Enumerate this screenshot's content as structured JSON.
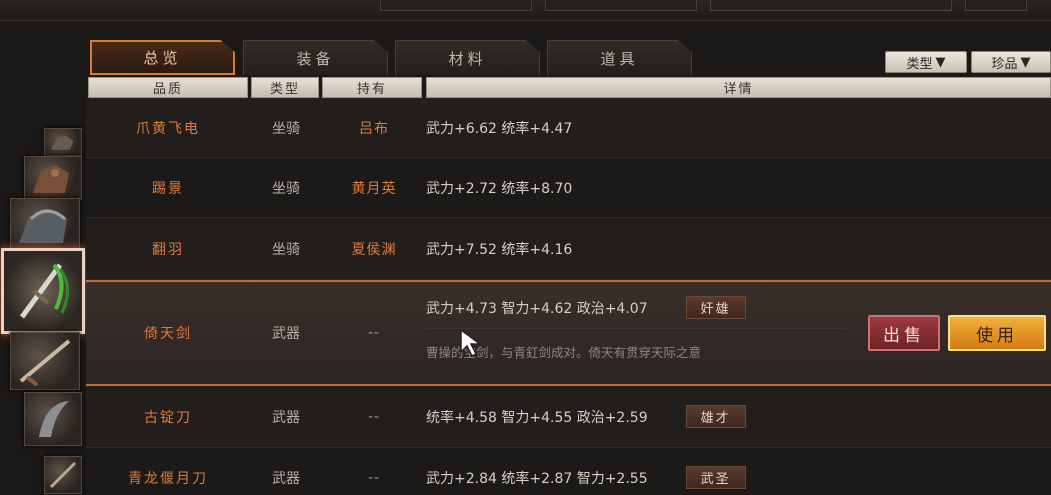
{
  "tabs": [
    {
      "label": "总览",
      "active": true
    },
    {
      "label": "装备",
      "active": false
    },
    {
      "label": "材料",
      "active": false
    },
    {
      "label": "道具",
      "active": false
    }
  ],
  "filters": {
    "type_label": "类型",
    "rare_label": "珍品",
    "arrow": "▼"
  },
  "headers": {
    "quality": "品质",
    "type": "类型",
    "owner": "持有",
    "detail": "详情"
  },
  "rows": [
    {
      "name": "爪黄飞电",
      "type": "坐骑",
      "owner": "吕布",
      "detail": "武力+6.62  统率+4.47"
    },
    {
      "name": "踢景",
      "type": "坐骑",
      "owner": "黄月英",
      "detail": "武力+2.72  统率+8.70"
    },
    {
      "name": "翻羽",
      "type": "坐骑",
      "owner": "夏侯渊",
      "detail": "武力+7.52  统率+4.16"
    },
    {
      "name": "倚天剑",
      "type": "武器",
      "owner": "--",
      "detail": "武力+4.73  智力+4.62  政治+4.07",
      "badge": "奸雄",
      "description": "曹操的宝剑，与青釭剑成对。倚天有贯穿天际之意"
    },
    {
      "name": "古锭刀",
      "type": "武器",
      "owner": "--",
      "detail": "统率+4.58  智力+4.55  政治+2.59",
      "badge": "雄才"
    },
    {
      "name": "青龙偃月刀",
      "type": "武器",
      "owner": "--",
      "detail": "武力+2.84  统率+2.87  智力+2.55",
      "badge": "武圣"
    }
  ],
  "actions": {
    "sell": "出售",
    "use": "使用"
  },
  "colors": {
    "accent": "#d8793a",
    "name_orange": "#e07a3e",
    "use_gold": "#f4b13c",
    "sell_red": "#9c3b3e"
  },
  "icons": [
    "horse-icon",
    "sword-icon",
    "blade-icon"
  ]
}
